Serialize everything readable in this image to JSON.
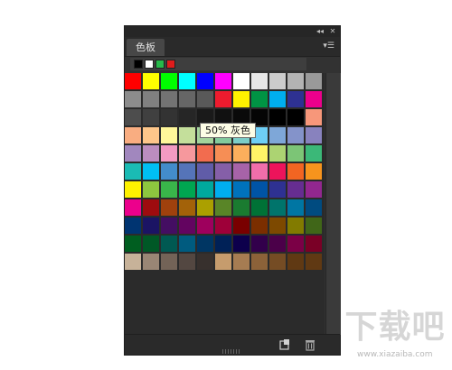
{
  "panel": {
    "collapse_icon": "double-chevron-left-icon",
    "close_icon": "close-icon",
    "tab_label": "色板",
    "menu_icon": "panel-menu-icon"
  },
  "recent_colors": [
    "#000000",
    "#ffffff",
    "#27b94a",
    "#e01c1c"
  ],
  "swatches": [
    [
      "#ff0000",
      "#ffff00",
      "#00ff00",
      "#00ffff",
      "#0000ff",
      "#ff00ff",
      "#ffffff",
      "#e6e6e6",
      "#cccccc",
      "#b3b3b3",
      "#999999"
    ],
    [
      "#8c8c8c",
      "#808080",
      "#737373",
      "#666666",
      "#595959",
      "#ee1b2e",
      "#fff200",
      "#009444",
      "#00aeef",
      "#2e3192",
      "#ec008c"
    ],
    [
      "#4d4d4d",
      "#404040",
      "#333333",
      "#262626",
      "#1a1a1a",
      "#111111",
      "#0a0a0a",
      "#050505",
      "#000000",
      "#000000",
      "#f7977a"
    ],
    [
      "#f9ad81",
      "#fdc68a",
      "#fff79a",
      "#c4df9b",
      "#a3d39c",
      "#82ca9d",
      "#7bcdc8",
      "#6ecff6",
      "#7ea7d8",
      "#8493ca",
      "#8882be"
    ],
    [
      "#a187be",
      "#bc8dbf",
      "#f49ac2",
      "#f6989d",
      "#f26c4f",
      "#f68e55",
      "#fbaf5c",
      "#fff467",
      "#acd372",
      "#7cc576",
      "#3bb878"
    ],
    [
      "#1abbb4",
      "#00bff3",
      "#438ccb",
      "#5574b9",
      "#605ca8",
      "#855fa8",
      "#a763a8",
      "#f06eaa",
      "#ed145b",
      "#f26522",
      "#f7941d"
    ],
    [
      "#fff200",
      "#8dc63f",
      "#39b54a",
      "#00a651",
      "#00a99d",
      "#00aeef",
      "#0072bc",
      "#0054a6",
      "#2e3192",
      "#662d91",
      "#92278f"
    ],
    [
      "#ec008c",
      "#9e0b0f",
      "#a0410d",
      "#a36209",
      "#aba000",
      "#598527",
      "#1a7b30",
      "#007236",
      "#00746b",
      "#0076a3",
      "#004b80"
    ],
    [
      "#003471",
      "#1b1464",
      "#440e62",
      "#630460",
      "#9e005d",
      "#9e0039",
      "#790000",
      "#7b2e00",
      "#7d4900",
      "#827b00",
      "#406618"
    ],
    [
      "#005e20",
      "#005826",
      "#005952",
      "#005b7f",
      "#003663",
      "#002157",
      "#0d004c",
      "#32004b",
      "#4b0049",
      "#7b0046",
      "#7a0026"
    ],
    [
      "#c7b299",
      "#998675",
      "#736357",
      "#534741",
      "#37302d",
      "#c69c6d",
      "#a67c52",
      "#8c6239",
      "#754c24",
      "#603913",
      "#603913"
    ]
  ],
  "tooltip": "50% 灰色",
  "bottom": {
    "new_swatch_icon": "new-swatch-icon",
    "trash_icon": "trash-icon"
  },
  "watermark": {
    "text": "下载吧",
    "url": "www.xiazaiba.com"
  }
}
